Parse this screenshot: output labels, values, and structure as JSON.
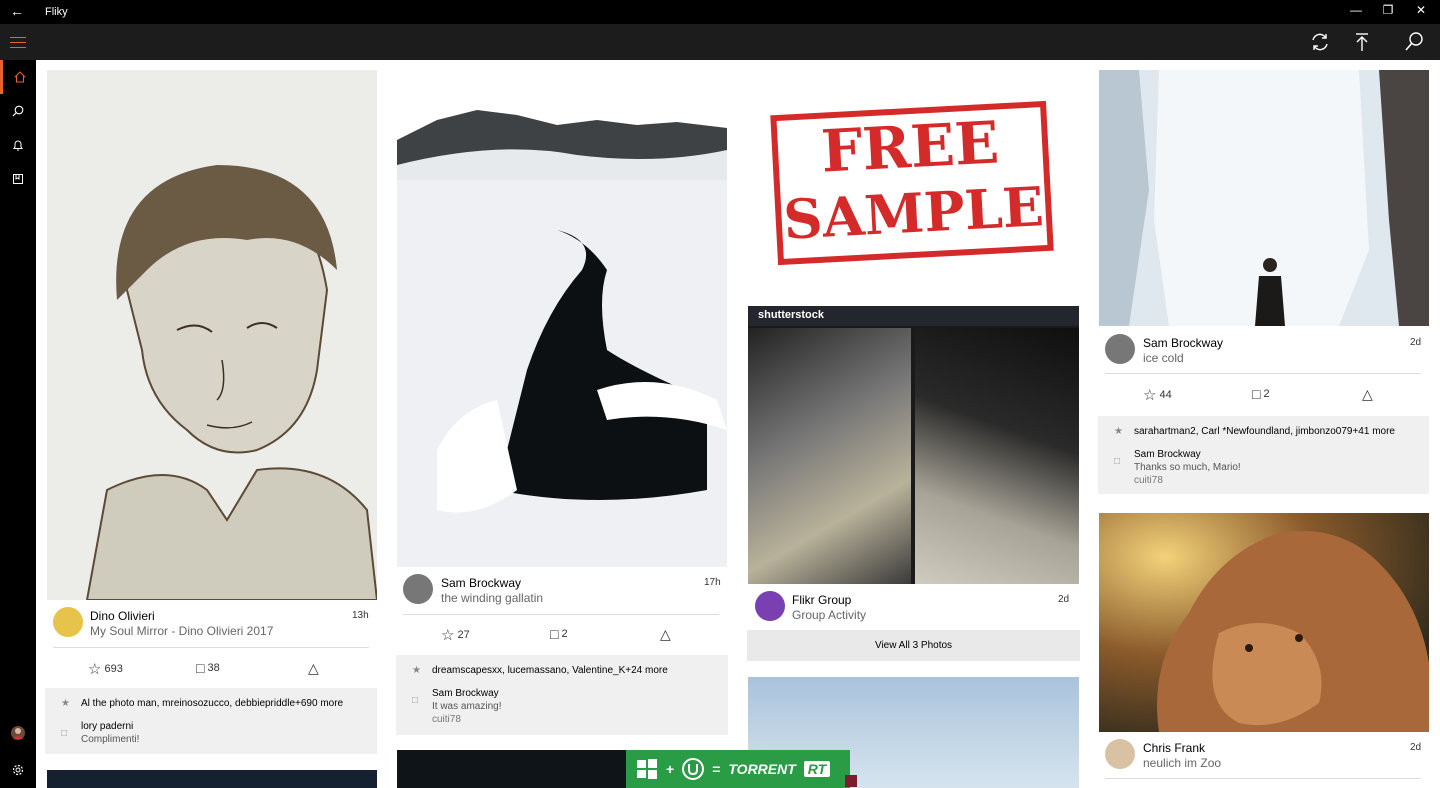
{
  "window": {
    "title": "Fliky"
  },
  "feed": [
    {
      "owner": "Dino Olivieri",
      "title": "My Soul Mirror - Dino Olivieri 2017",
      "age": "13h",
      "faves": "693",
      "comments": "38",
      "faved_by": "Al the photo man, mreinosozucco, debbiepriddle+690 more",
      "comment_author": "lory paderni",
      "comment_text": "Complimenti!"
    },
    {
      "owner": "Sam Brockway",
      "title": "the winding gallatin",
      "age": "17h",
      "faves": "27",
      "comments": "2",
      "faved_by": "dreamscapesxx, lucemassano, Valentine_K+24 more",
      "comment_author": "Sam Brockway",
      "comment_text": "It was amazing!",
      "comment_reply": "cuiti78"
    },
    {
      "owner": "Flikr Group",
      "title": "Group Activity",
      "age": "2d",
      "free_sample_line1": "FREE",
      "free_sample_line2": "SAMPLE",
      "shutterstock_label": "shutterstock",
      "view_all": "View All 3 Photos"
    },
    {
      "owner": "Sam Brockway",
      "title": "ice cold",
      "age": "2d",
      "faves": "44",
      "comments": "2",
      "faved_by": "sarahartman2, Carl *Newfoundland, jimbonzo079+41 more",
      "comment_author": "Sam Brockway",
      "comment_text": "Thanks so much, Mario!",
      "comment_reply": "cuiti78"
    },
    {
      "owner": "Chris Frank",
      "title": "neulich im Zoo",
      "age": "2d"
    }
  ],
  "banner": {
    "torrent": "TORRENT",
    "rt": "RT",
    "plus": "+",
    "equals": "="
  },
  "colors": {
    "accent": "#e8632b",
    "banner": "#2b9c46"
  }
}
